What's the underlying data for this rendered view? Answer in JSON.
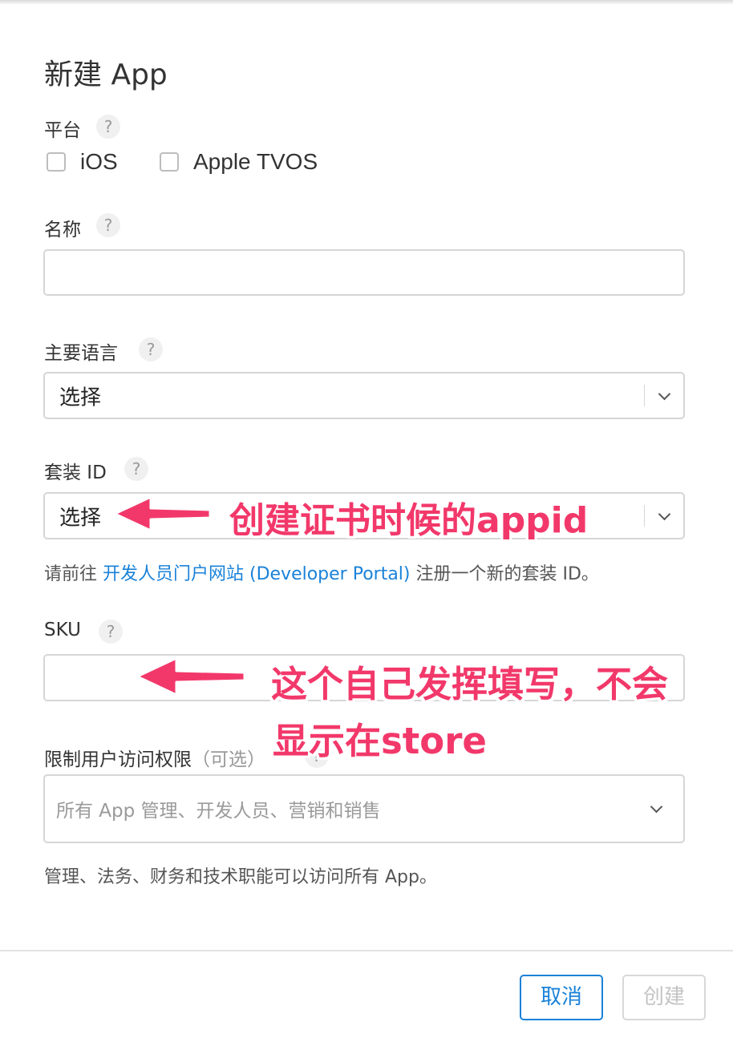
{
  "dialog": {
    "title": "新建 App",
    "help_symbol": "?"
  },
  "platform": {
    "label": "平台",
    "options": [
      "iOS",
      "Apple TVOS"
    ]
  },
  "name": {
    "label": "名称",
    "value": ""
  },
  "primary_language": {
    "label": "主要语言",
    "value": "选择"
  },
  "bundle_id": {
    "label": "套装 ID",
    "value": "选择",
    "hint_prefix": "请前往 ",
    "hint_link": "开发人员门户网站 (Developer Portal)",
    "hint_suffix": " 注册一个新的套装 ID。"
  },
  "sku": {
    "label": "SKU",
    "value": ""
  },
  "user_access": {
    "label": "限制用户访问权限",
    "optional": "（可选）",
    "placeholder": "所有 App 管理、开发人员、营销和销售",
    "hint": "管理、法务、财务和技术职能可以访问所有 App。"
  },
  "buttons": {
    "cancel": "取消",
    "create": "创建"
  },
  "annotations": {
    "bundle_note": "创建证书时候的appid",
    "sku_note_line1": "这个自己发挥填写，不会",
    "sku_note_line2": "显示在store"
  },
  "colors": {
    "link": "#1a82d9",
    "annotation": "#f2386a",
    "disabled_text": "#c4c4c4"
  }
}
